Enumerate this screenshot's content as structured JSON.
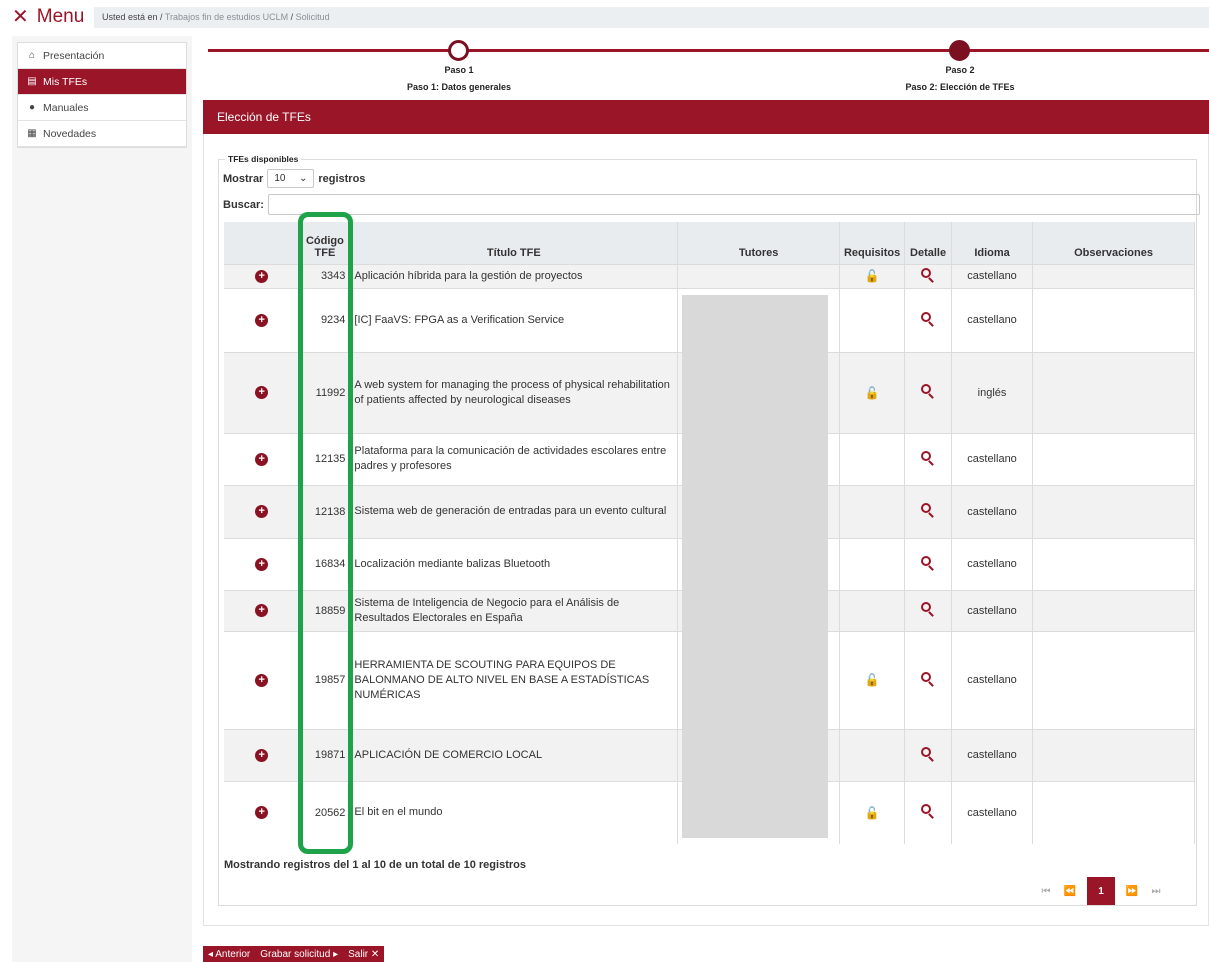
{
  "menu": {
    "label": "Menu"
  },
  "breadcrumb": {
    "prefix": "Usted está en",
    "items": [
      "Trabajos fin de estudios UCLM",
      "Solicitud"
    ]
  },
  "sidebar": {
    "items": [
      {
        "label": "Presentación",
        "icon": "home-icon",
        "active": false
      },
      {
        "label": "Mis TFEs",
        "icon": "document-icon",
        "active": true
      },
      {
        "label": "Manuales",
        "icon": "info-icon",
        "active": false
      },
      {
        "label": "Novedades",
        "icon": "news-icon",
        "active": false
      }
    ]
  },
  "steps": [
    {
      "title": "Paso 1",
      "subtitle": "Paso 1: Datos generales"
    },
    {
      "title": "Paso 2",
      "subtitle": "Paso 2: Elección de TFEs"
    }
  ],
  "section": {
    "title": "Elección de TFEs"
  },
  "fieldset": {
    "legend": "TFEs disponibles"
  },
  "length": {
    "before": "Mostrar",
    "value": "10",
    "after": "registros"
  },
  "search": {
    "label": "Buscar:",
    "value": ""
  },
  "table": {
    "headers": {
      "code": "Código TFE",
      "title": "Título TFE",
      "tutors": "Tutores",
      "req": "Requisitos",
      "detail": "Detalle",
      "lang": "Idioma",
      "obs": "Observaciones"
    },
    "rows": [
      {
        "code": "3343",
        "title": "Aplicación híbrida para la gestión de proyectos",
        "lock": true,
        "lang": "castellano"
      },
      {
        "code": "9234",
        "title": "[IC] FaaVS: FPGA as a Verification Service",
        "lock": false,
        "lang": "castellano"
      },
      {
        "code": "11992",
        "title": "A web system for managing the process of physical rehabilitation of patients affected by neurological diseases",
        "lock": true,
        "lang": "inglés"
      },
      {
        "code": "12135",
        "title": "Plataforma para la comunicación de actividades escolares entre padres y profesores",
        "lock": false,
        "lang": "castellano"
      },
      {
        "code": "12138",
        "title": "Sistema web de generación de entradas para un evento cultural",
        "lock": false,
        "lang": "castellano"
      },
      {
        "code": "16834",
        "title": "Localización mediante balizas Bluetooth",
        "lock": false,
        "lang": "castellano"
      },
      {
        "code": "18859",
        "title": "Sistema de Inteligencia de Negocio para el Análisis de Resultados Electorales en España",
        "lock": false,
        "lang": "castellano"
      },
      {
        "code": "19857",
        "title": "HERRAMIENTA DE SCOUTING PARA EQUIPOS DE BALONMANO DE ALTO NIVEL EN BASE A ESTADÍSTICAS NUMÉRICAS",
        "lock": true,
        "lang": "castellano"
      },
      {
        "code": "19871",
        "title": "APLICACIÓN DE COMERCIO LOCAL",
        "lock": false,
        "lang": "castellano"
      },
      {
        "code": "20562",
        "title": "El bit en el mundo",
        "lock": true,
        "lang": "castellano"
      }
    ]
  },
  "info": "Mostrando registros del 1 al 10 de un total de 10 registros",
  "pagination": {
    "current": "1"
  },
  "actions": {
    "prev": "Anterior",
    "save": "Grabar solicitud",
    "exit": "Salir"
  },
  "colors": {
    "accent": "#9b1528",
    "highlight": "#1fa34a"
  }
}
